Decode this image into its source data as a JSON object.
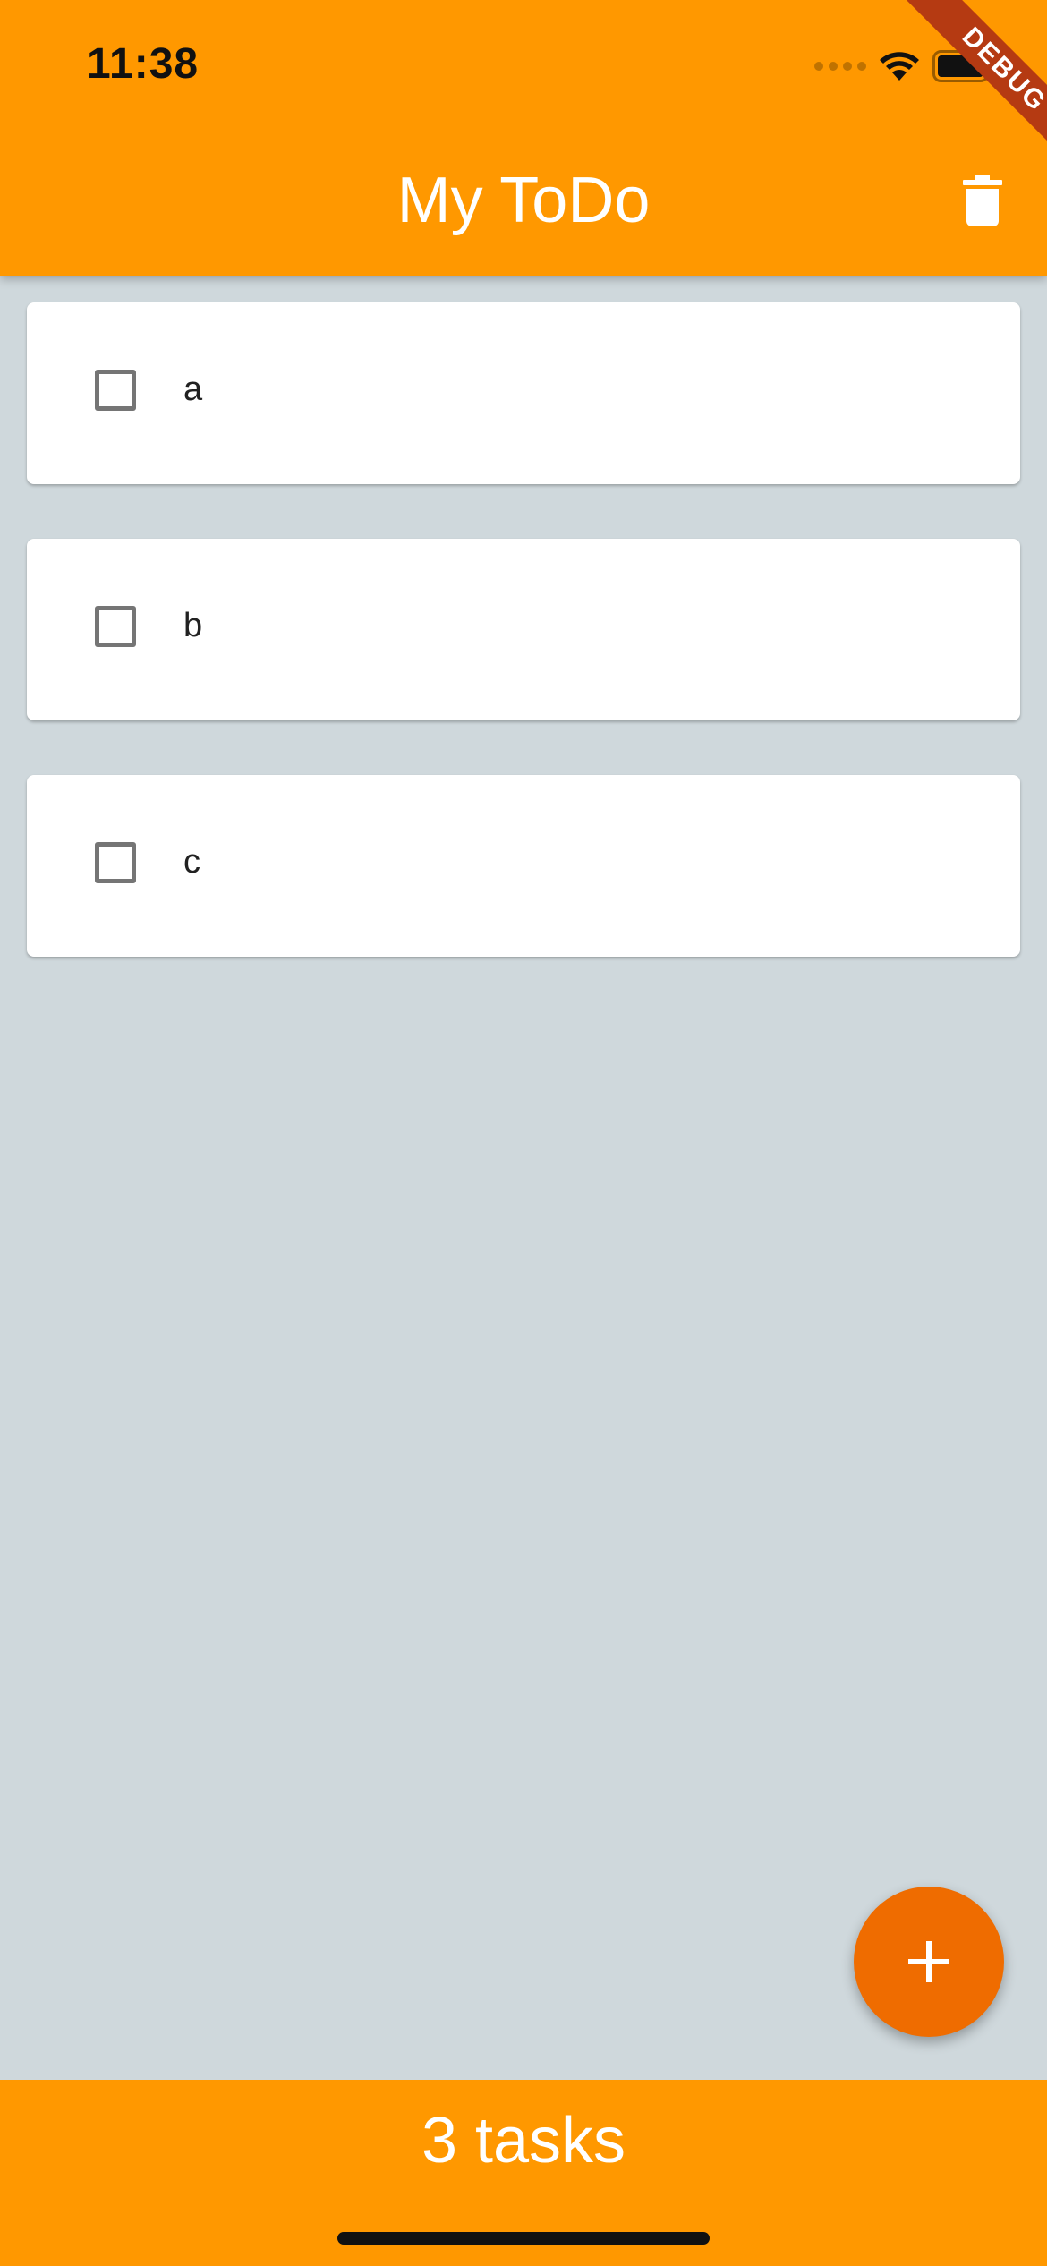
{
  "status_bar": {
    "time": "11:38"
  },
  "app_bar": {
    "title": "My ToDo",
    "debug_banner": "DEBUG"
  },
  "tasks": [
    {
      "label": "a",
      "checked": false
    },
    {
      "label": "b",
      "checked": false
    },
    {
      "label": "c",
      "checked": false
    }
  ],
  "footer": {
    "count_text": "3 tasks"
  },
  "colors": {
    "primary": "#ff9800",
    "accent": "#ef6c00",
    "background": "#cfd8dc"
  },
  "icons": {
    "delete": "trash-icon",
    "add": "plus-icon"
  }
}
